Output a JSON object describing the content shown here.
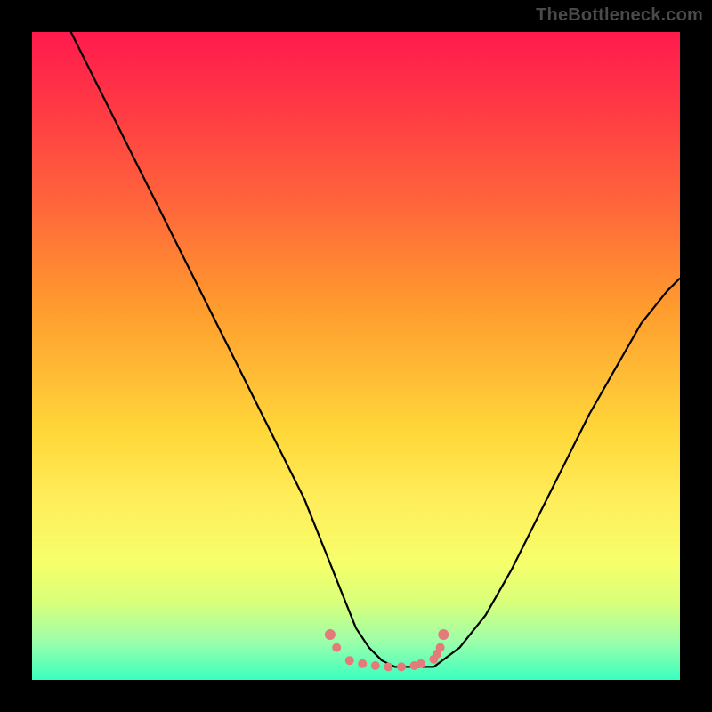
{
  "watermark": "TheBottleneck.com",
  "chart_data": {
    "type": "line",
    "title": "",
    "xlabel": "",
    "ylabel": "",
    "xlim": [
      0,
      100
    ],
    "ylim": [
      0,
      100
    ],
    "series": [
      {
        "name": "bottleneck-curve",
        "x": [
          6,
          10,
          14,
          18,
          22,
          26,
          30,
          34,
          38,
          42,
          46,
          48,
          50,
          52,
          54,
          56,
          58,
          62,
          66,
          70,
          74,
          78,
          82,
          86,
          90,
          94,
          98,
          100
        ],
        "y": [
          100,
          92,
          84,
          76,
          68,
          60,
          52,
          44,
          36,
          28,
          18,
          13,
          8,
          5,
          3,
          2,
          2,
          2,
          5,
          10,
          17,
          25,
          33,
          41,
          48,
          55,
          60,
          62
        ]
      },
      {
        "name": "bottleneck-highlight-dots",
        "x": [
          46,
          47,
          49,
          51,
          53,
          55,
          57,
          59,
          60,
          62,
          62.5,
          63,
          63.5
        ],
        "y": [
          7,
          5,
          3,
          2.5,
          2.2,
          2,
          2,
          2.2,
          2.5,
          3.2,
          4,
          5,
          7
        ]
      }
    ],
    "colors": {
      "curve": "#000000",
      "dots": "#e47a7a"
    }
  }
}
